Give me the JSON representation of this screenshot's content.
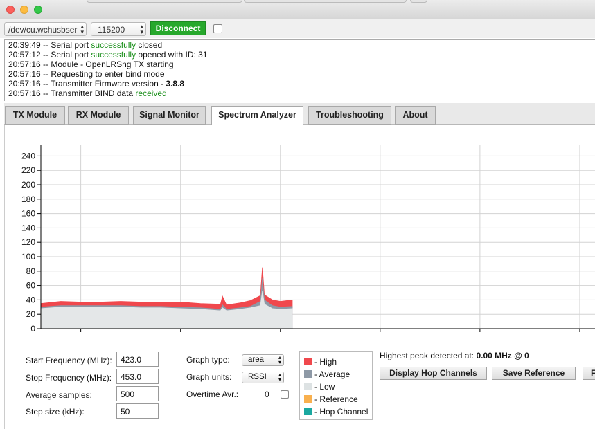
{
  "window": {
    "traffic_lights": [
      "close",
      "minimize",
      "zoom"
    ]
  },
  "toolbar": {
    "port": "/dev/cu.wchusbser",
    "baud": "115200",
    "disconnect_label": "Disconnect",
    "auto_connect_checked": false
  },
  "log": [
    {
      "time": "20:39:49",
      "pre": " -- Serial port ",
      "good": "successfully",
      "post": " closed",
      "bold": ""
    },
    {
      "time": "20:57:12",
      "pre": " -- Serial port ",
      "good": "successfully",
      "post": " opened with ID: 31",
      "bold": ""
    },
    {
      "time": "20:57:16",
      "pre": " -- Module - OpenLRSng TX starting",
      "good": "",
      "post": "",
      "bold": ""
    },
    {
      "time": "20:57:16",
      "pre": " -- Requesting to enter bind mode",
      "good": "",
      "post": "",
      "bold": ""
    },
    {
      "time": "20:57:16",
      "pre": " -- Transmitter Firmware version - ",
      "good": "",
      "post": "",
      "bold": "3.8.8"
    },
    {
      "time": "20:57:16",
      "pre": " -- Transmitter BIND data ",
      "good": "received",
      "post": "",
      "bold": ""
    }
  ],
  "tabs": [
    {
      "label": "TX Module",
      "active": false
    },
    {
      "label": "RX Module",
      "active": false
    },
    {
      "label": "Signal Monitor",
      "active": false
    },
    {
      "label": "Spectrum Analyzer",
      "active": true
    },
    {
      "label": "Troubleshooting",
      "active": false
    },
    {
      "label": "About",
      "active": false
    }
  ],
  "chart_data": {
    "type": "area",
    "xlabel": "",
    "ylabel": "",
    "xlim": [
      423,
      450.8
    ],
    "ylim": [
      0,
      250
    ],
    "x_ticks": [
      425,
      430,
      435,
      440,
      445,
      450
    ],
    "y_ticks": [
      0,
      20,
      40,
      60,
      80,
      100,
      120,
      140,
      160,
      180,
      200,
      220,
      240
    ],
    "grid": true,
    "data_range": [
      423.0,
      435.6
    ],
    "series": [
      {
        "name": "High",
        "color": "#f0484d",
        "points": [
          [
            423.0,
            35
          ],
          [
            424.0,
            38
          ],
          [
            425.0,
            37
          ],
          [
            426.0,
            37
          ],
          [
            427.0,
            38
          ],
          [
            428.0,
            37
          ],
          [
            429.0,
            37
          ],
          [
            430.0,
            37
          ],
          [
            431.0,
            35
          ],
          [
            432.0,
            34
          ],
          [
            432.1,
            45
          ],
          [
            432.3,
            33
          ],
          [
            433.0,
            36
          ],
          [
            433.5,
            39
          ],
          [
            434.0,
            46
          ],
          [
            434.1,
            85
          ],
          [
            434.2,
            47
          ],
          [
            434.6,
            40
          ],
          [
            435.0,
            38
          ],
          [
            435.6,
            40
          ]
        ]
      },
      {
        "name": "Average",
        "color": "#8e99a6",
        "points": [
          [
            423.0,
            30
          ],
          [
            424.0,
            32
          ],
          [
            425.0,
            32
          ],
          [
            426.0,
            32
          ],
          [
            427.0,
            32
          ],
          [
            428.0,
            31
          ],
          [
            429.0,
            31
          ],
          [
            430.0,
            30
          ],
          [
            431.0,
            29
          ],
          [
            432.0,
            27
          ],
          [
            432.1,
            33
          ],
          [
            432.3,
            27
          ],
          [
            433.0,
            29
          ],
          [
            433.5,
            31
          ],
          [
            434.0,
            38
          ],
          [
            434.1,
            70
          ],
          [
            434.2,
            40
          ],
          [
            434.6,
            32
          ],
          [
            435.0,
            30
          ],
          [
            435.6,
            31
          ]
        ]
      },
      {
        "name": "Low",
        "color": "#e4e7e8",
        "points": [
          [
            423.0,
            28
          ],
          [
            424.0,
            30
          ],
          [
            425.0,
            30
          ],
          [
            426.0,
            30
          ],
          [
            427.0,
            30
          ],
          [
            428.0,
            29
          ],
          [
            429.0,
            29
          ],
          [
            430.0,
            28
          ],
          [
            431.0,
            27
          ],
          [
            432.0,
            25
          ],
          [
            432.1,
            29
          ],
          [
            432.3,
            25
          ],
          [
            433.0,
            27
          ],
          [
            433.5,
            29
          ],
          [
            434.0,
            32
          ],
          [
            434.1,
            52
          ],
          [
            434.2,
            34
          ],
          [
            434.6,
            28
          ],
          [
            435.0,
            27
          ],
          [
            435.6,
            28
          ]
        ]
      }
    ]
  },
  "controls": {
    "start_freq_label": "Start Frequency (MHz):",
    "start_freq_value": "423.0",
    "stop_freq_label": "Stop Frequency (MHz):",
    "stop_freq_value": "453.0",
    "avg_samples_label": "Average samples:",
    "avg_samples_value": "500",
    "step_size_label": "Step size (kHz):",
    "step_size_value": "50",
    "graph_type_label": "Graph type:",
    "graph_type_value": "area",
    "graph_units_label": "Graph units:",
    "graph_units_value": "RSSI",
    "overtime_label": "Overtime Avr.:",
    "overtime_value": "0"
  },
  "legend": [
    {
      "label": "- High",
      "color": "#f0484d"
    },
    {
      "label": "- Average",
      "color": "#8e99a6"
    },
    {
      "label": "- Low",
      "color": "#dde2e3"
    },
    {
      "label": "- Reference",
      "color": "#f9b04e"
    },
    {
      "label": "- Hop Channel",
      "color": "#1aa8a0"
    }
  ],
  "peak": {
    "prefix": "Highest peak detected at: ",
    "value": "0.00 MHz @ 0"
  },
  "buttons": {
    "hop_channels": "Display Hop Channels",
    "save_reference": "Save Reference",
    "partial": "F"
  }
}
